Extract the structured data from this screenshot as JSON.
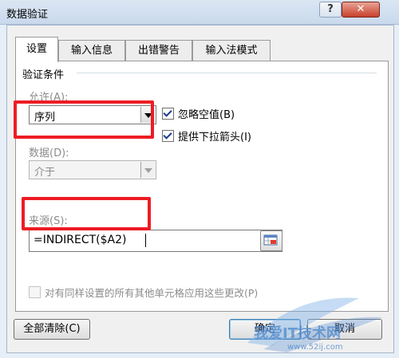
{
  "window": {
    "title": "数据验证",
    "help_label": "?",
    "close_label": "✕"
  },
  "tabs": [
    "设置",
    "输入信息",
    "出错警告",
    "输入法模式"
  ],
  "section": {
    "title": "验证条件"
  },
  "allow": {
    "label": "允许(A):",
    "value": "序列"
  },
  "ignore_blank": {
    "label": "忽略空值(B)",
    "checked": true
  },
  "dropdown": {
    "label": "提供下拉箭头(I)",
    "checked": true
  },
  "data": {
    "label": "数据(D):",
    "value": "介于"
  },
  "source": {
    "label": "来源(S):",
    "value": "=INDIRECT($A2)"
  },
  "apply_all": {
    "label": "对有同样设置的所有其他单元格应用这些更改(P)",
    "checked": false
  },
  "buttons": {
    "clear": "全部清除(C)",
    "ok": "确定",
    "cancel": "取消"
  },
  "watermark": {
    "brand": "我爱IT技术网",
    "url": "www.52ij.com"
  },
  "colors": {
    "highlight": "#ee1c24",
    "title_bar": "#c9d9ec",
    "close_button": "#c8402c"
  }
}
